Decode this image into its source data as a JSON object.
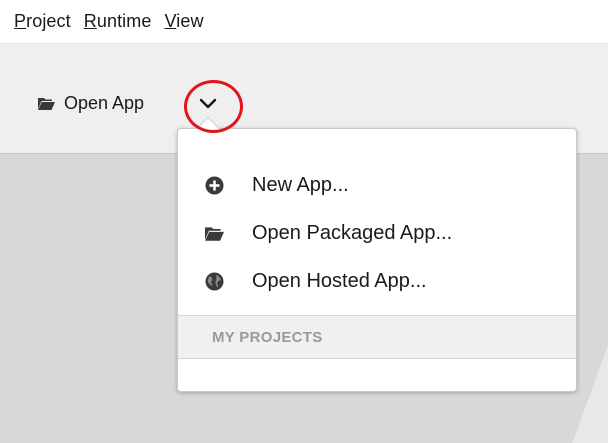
{
  "menubar": {
    "items": [
      {
        "label": "Project",
        "mnemonic": "P",
        "rest": "roject",
        "icon": null
      },
      {
        "label": "Runtime",
        "mnemonic": "R",
        "rest": "untime",
        "icon": null
      },
      {
        "label": "View",
        "mnemonic": "V",
        "rest": "iew",
        "icon": null
      }
    ]
  },
  "toolbar": {
    "open_app_label": "Open App",
    "open_app_icon": "folder-open-icon",
    "dropdown_icon": "chevron-down-icon",
    "play_icon": "play-icon"
  },
  "dropdown": {
    "items": [
      {
        "label": "New App...",
        "icon": "plus-circle-icon"
      },
      {
        "label": "Open Packaged App...",
        "icon": "folder-open-icon"
      },
      {
        "label": "Open Hosted App...",
        "icon": "globe-icon"
      }
    ],
    "section_header": "MY PROJECTS",
    "projects": []
  },
  "colors": {
    "highlight": "#e0141c",
    "icon": "#3a3a3a",
    "section_text": "#9a9a9a"
  }
}
